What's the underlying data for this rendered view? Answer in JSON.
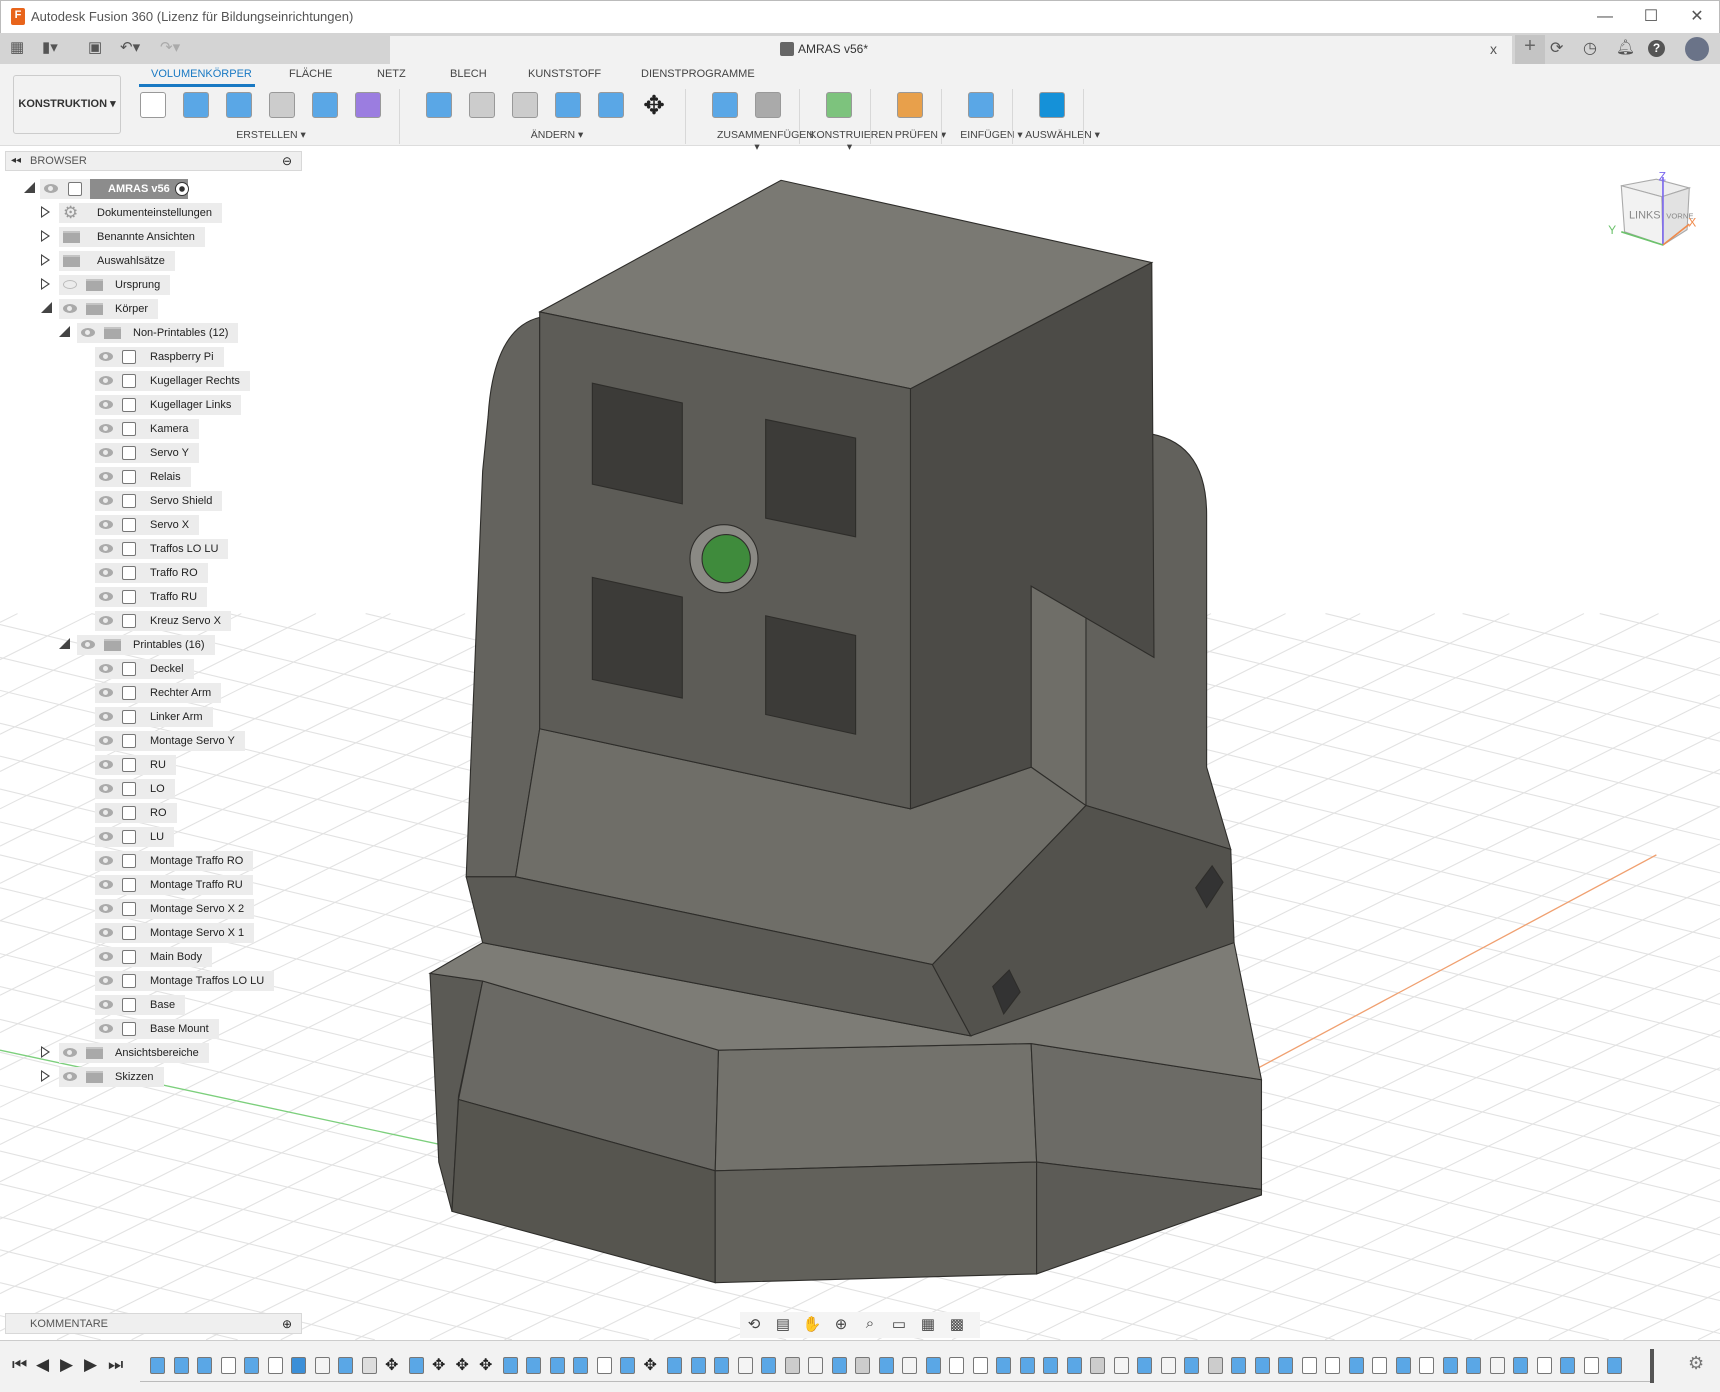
{
  "app": {
    "title": "Autodesk Fusion 360 (Lizenz für Bildungseinrichtungen)",
    "logo": "F"
  },
  "window": {
    "minimize": "—",
    "maximize": "☐",
    "close": "✕"
  },
  "document": {
    "title": "AMRAS v56*",
    "close": "x"
  },
  "quick_access": [
    "grid-menu-icon",
    "file-icon",
    "save-icon",
    "undo-icon",
    "redo-icon"
  ],
  "top_right_icons": [
    "new-tab-plus-icon",
    "extensions-icon",
    "job-status-icon",
    "notifications-icon",
    "help-icon",
    "user-avatar"
  ],
  "ribbon": {
    "workspace": "KONSTRUKTION ▾",
    "tabs": [
      "VOLUMENKÖRPER",
      "FLÄCHE",
      "NETZ",
      "BLECH",
      "KUNSTSTOFF",
      "DIENSTPROGRAMME"
    ],
    "active_tab": "VOLUMENKÖRPER",
    "groups": [
      {
        "label": "ERSTELLEN ▾",
        "tools": [
          "create-sketch",
          "extrude",
          "revolve",
          "hole",
          "pattern",
          "create-form"
        ]
      },
      {
        "label": "ÄNDERN ▾",
        "tools": [
          "press-pull",
          "fillet",
          "shell",
          "combine",
          "split-face",
          "move"
        ]
      },
      {
        "label": "ZUSAMMENFÜGEN ▾",
        "tools": [
          "new-component",
          "joint"
        ]
      },
      {
        "label": "KONSTRUIEREN ▾",
        "tools": [
          "offset-plane"
        ]
      },
      {
        "label": "PRÜFEN ▾",
        "tools": [
          "measure"
        ]
      },
      {
        "label": "EINFÜGEN ▾",
        "tools": [
          "insert-image"
        ]
      },
      {
        "label": "AUSWÄHLEN ▾",
        "tools": [
          "select"
        ]
      }
    ]
  },
  "browser": {
    "title": "BROWSER",
    "items": [
      {
        "level": 0,
        "toggle": "open",
        "eye": "on",
        "icon": "component",
        "label": "AMRAS v56"
      },
      {
        "level": 1,
        "toggle": "closed",
        "eye": "none",
        "icon": "gear",
        "label": "Dokumenteinstellungen"
      },
      {
        "level": 1,
        "toggle": "closed",
        "eye": "none",
        "icon": "folder",
        "label": "Benannte Ansichten"
      },
      {
        "level": 1,
        "toggle": "closed",
        "eye": "none",
        "icon": "folder",
        "label": "Auswahlsätze"
      },
      {
        "level": 1,
        "toggle": "closed",
        "eye": "off",
        "icon": "folder",
        "label": "Ursprung"
      },
      {
        "level": 1,
        "toggle": "open",
        "eye": "on",
        "icon": "folder",
        "label": "Körper"
      },
      {
        "level": 2,
        "toggle": "open",
        "eye": "on",
        "icon": "folder",
        "label": "Non-Printables (12)"
      },
      {
        "level": 3,
        "eye": "on",
        "icon": "body",
        "label": "Raspberry Pi"
      },
      {
        "level": 3,
        "eye": "on",
        "icon": "body",
        "label": "Kugellager Rechts"
      },
      {
        "level": 3,
        "eye": "on",
        "icon": "body",
        "label": "Kugellager Links"
      },
      {
        "level": 3,
        "eye": "on",
        "icon": "body",
        "label": "Kamera"
      },
      {
        "level": 3,
        "eye": "on",
        "icon": "body",
        "label": "Servo Y"
      },
      {
        "level": 3,
        "eye": "on",
        "icon": "body",
        "label": "Relais"
      },
      {
        "level": 3,
        "eye": "on",
        "icon": "body",
        "label": "Servo Shield"
      },
      {
        "level": 3,
        "eye": "on",
        "icon": "body",
        "label": "Servo X"
      },
      {
        "level": 3,
        "eye": "on",
        "icon": "body",
        "label": "Traffos LO LU"
      },
      {
        "level": 3,
        "eye": "on",
        "icon": "body",
        "label": "Traffo RO"
      },
      {
        "level": 3,
        "eye": "on",
        "icon": "body",
        "label": "Traffo RU"
      },
      {
        "level": 3,
        "eye": "on",
        "icon": "body",
        "label": "Kreuz Servo X"
      },
      {
        "level": 2,
        "toggle": "open",
        "eye": "on",
        "icon": "folder",
        "label": "Printables (16)"
      },
      {
        "level": 3,
        "eye": "on",
        "icon": "body",
        "label": "Deckel"
      },
      {
        "level": 3,
        "eye": "on",
        "icon": "body",
        "label": "Rechter Arm"
      },
      {
        "level": 3,
        "eye": "on",
        "icon": "body",
        "label": "Linker Arm"
      },
      {
        "level": 3,
        "eye": "on",
        "icon": "body",
        "label": "Montage Servo Y"
      },
      {
        "level": 3,
        "eye": "on",
        "icon": "body",
        "label": "RU"
      },
      {
        "level": 3,
        "eye": "on",
        "icon": "body",
        "label": "LO"
      },
      {
        "level": 3,
        "eye": "on",
        "icon": "body",
        "label": "RO"
      },
      {
        "level": 3,
        "eye": "on",
        "icon": "body",
        "label": "LU"
      },
      {
        "level": 3,
        "eye": "on",
        "icon": "body",
        "label": "Montage Traffo RO"
      },
      {
        "level": 3,
        "eye": "on",
        "icon": "body",
        "label": "Montage Traffo RU"
      },
      {
        "level": 3,
        "eye": "on",
        "icon": "body",
        "label": "Montage Servo X 2"
      },
      {
        "level": 3,
        "eye": "on",
        "icon": "body",
        "label": "Montage Servo X 1"
      },
      {
        "level": 3,
        "eye": "on",
        "icon": "body",
        "label": "Main Body"
      },
      {
        "level": 3,
        "eye": "on",
        "icon": "body",
        "label": "Montage Traffos LO LU"
      },
      {
        "level": 3,
        "eye": "on",
        "icon": "body",
        "label": "Base"
      },
      {
        "level": 3,
        "eye": "on",
        "icon": "body",
        "label": "Base Mount"
      },
      {
        "level": 1,
        "toggle": "closed",
        "eye": "on",
        "icon": "folder",
        "label": "Ansichtsbereiche"
      },
      {
        "level": 1,
        "toggle": "closed",
        "eye": "on",
        "icon": "folder",
        "label": "Skizzen"
      }
    ]
  },
  "viewcube": {
    "face_front": "LINKS",
    "face_side": "VORNE",
    "axis_z": "Z",
    "axis_x": "X",
    "axis_y": "Y"
  },
  "comments": {
    "title": "KOMMENTARE"
  },
  "navbar": [
    "orbit-icon",
    "look-at-icon",
    "pan-icon",
    "zoom-icon",
    "fit-icon",
    "display-settings-icon",
    "grid-settings-icon",
    "viewports-icon"
  ],
  "timeline": {
    "controls": [
      "first-icon",
      "previous-icon",
      "play-icon",
      "next-icon",
      "last-icon"
    ],
    "features": "EEESCSIKEJMCMMMEECCSEMEECKEFKEFEKESSECCEFKCKCFECCSSCSESECKESCSE"
  },
  "colors": {
    "accent": "#1979c3",
    "body": "#5f5e59",
    "green_button": "#3f8b3c",
    "axis_x": "#f08a4b",
    "axis_y": "#6cc26c",
    "axis_z": "#7b68ee"
  }
}
